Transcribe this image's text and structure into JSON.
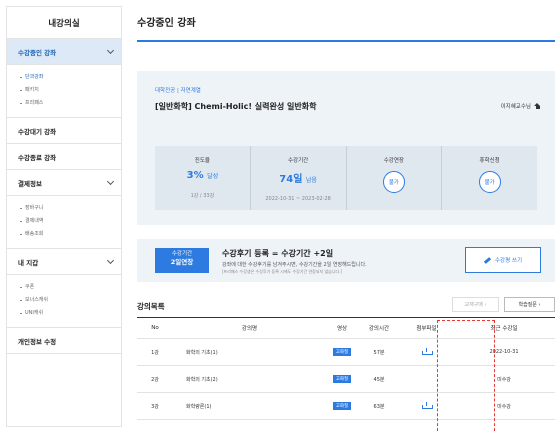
{
  "sidebar": {
    "title": "내강의실",
    "sections": [
      {
        "label": "수강중인 강좌",
        "active": true,
        "items": [
          "단과강좌",
          "패키지",
          "프리패스"
        ]
      },
      {
        "label": "수강대기 강좌"
      },
      {
        "label": "수강종료 강좌"
      },
      {
        "label": "결제정보",
        "items": [
          "장바구니",
          "결제내역",
          "배송조회"
        ]
      },
      {
        "label": "내 지갑",
        "items": [
          "쿠폰",
          "보너스캐쉬",
          "UNI캐쉬"
        ]
      },
      {
        "label": "개인정보 수정"
      }
    ]
  },
  "page": {
    "title": "수강중인 강좌"
  },
  "course": {
    "category": "대학전공 | 자연계열",
    "name": "[일반화학] Chemi-Holic! 실력완성 일반화학",
    "teacher": "이지혜교수님",
    "progress": {
      "label": "진도율",
      "value": "3%",
      "suffix": "달성",
      "detail": "1강 / 33강"
    },
    "period": {
      "label": "수강기간",
      "value": "74일",
      "suffix": "남음",
      "detail": "2022-10-31 ~ 2023-02-28"
    },
    "extend": {
      "label": "수강연장",
      "status": "불가"
    },
    "pause": {
      "label": "휴학신청",
      "status": "불가"
    }
  },
  "promo": {
    "badge_line1": "수강기간",
    "badge_line2": "2일연장",
    "title": "수강후기 등록 = 수강기간 +2일",
    "desc": "강좌에 대한 수강후기를 남겨주시면, 수강기간을 2일 연장해드립니다.",
    "note": "[프리패스 수강생은 수강후기 등록 시에도 수강기간 연장되지 않습니다.]",
    "button": "수강평 쓰기"
  },
  "lectures": {
    "title": "강의목록",
    "btn_textbook": "교재구매",
    "btn_qna": "학습질문",
    "headers": [
      "No",
      "강의명",
      "영상",
      "강의시간",
      "첨부파일",
      "최근 수강일"
    ],
    "rows": [
      {
        "no": "1강",
        "name": "화학의 기초(1)",
        "video": "고화질",
        "time": "57분",
        "attach": true,
        "recent": "2022-10-31"
      },
      {
        "no": "2강",
        "name": "화학의 기초(2)",
        "video": "고화질",
        "time": "45분",
        "attach": false,
        "recent": "미수강"
      },
      {
        "no": "3강",
        "name": "화학량론(1)",
        "video": "고화질",
        "time": "63분",
        "attach": true,
        "recent": "미수강"
      }
    ]
  },
  "colors": {
    "accent": "#2d7be0",
    "highlight_border": "#e53935"
  }
}
